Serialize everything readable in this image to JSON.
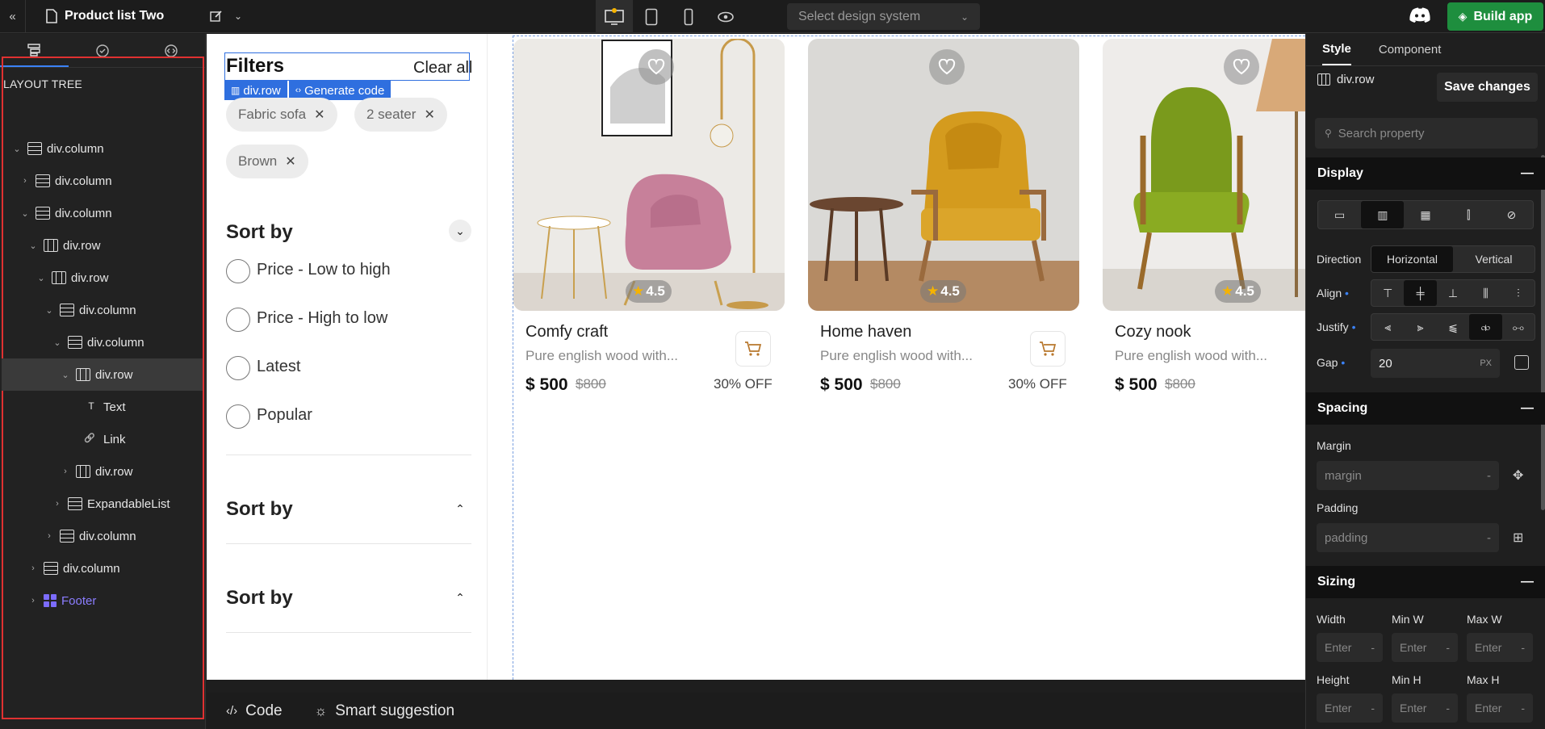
{
  "header": {
    "title": "Product list Two",
    "design_select_placeholder": "Select design system",
    "build_label": "Build app"
  },
  "left_panel": {
    "heading": "LAYOUT TREE",
    "tree": [
      {
        "label": "div.column",
        "icon": "column"
      },
      {
        "label": "div.column",
        "icon": "column"
      },
      {
        "label": "div.column",
        "icon": "column"
      },
      {
        "label": "div.row",
        "icon": "row"
      },
      {
        "label": "div.row",
        "icon": "row"
      },
      {
        "label": "div.column",
        "icon": "column"
      },
      {
        "label": "div.column",
        "icon": "column"
      },
      {
        "label": "div.row",
        "icon": "row"
      },
      {
        "label": "Text",
        "icon": "text"
      },
      {
        "label": "Link",
        "icon": "link"
      },
      {
        "label": "div.row",
        "icon": "row"
      },
      {
        "label": "ExpandableList",
        "icon": "list"
      },
      {
        "label": "div.column",
        "icon": "column"
      },
      {
        "label": "div.column",
        "icon": "column"
      },
      {
        "label": "Footer",
        "icon": "component"
      }
    ]
  },
  "canvas": {
    "filters": {
      "title": "Filters",
      "clear_all": "Clear all",
      "selection_tag": "div.row",
      "generate_code": "Generate code",
      "chips": [
        "Fabric sofa",
        "2 seater",
        "Brown"
      ],
      "sort_heading": "Sort by",
      "sort_options": [
        "Price - Low to high",
        "Price - High to low",
        "Latest",
        "Popular"
      ],
      "collapsed_sections": [
        "Sort by",
        "Sort by"
      ]
    },
    "products": [
      {
        "name": "Comfy craft",
        "desc": "Pure english wood with...",
        "price": "$ 500",
        "old_price": "$800",
        "discount": "30% OFF",
        "rating": "4.5"
      },
      {
        "name": "Home haven",
        "desc": "Pure english wood with...",
        "price": "$ 500",
        "old_price": "$800",
        "discount": "30% OFF",
        "rating": "4.5"
      },
      {
        "name": "Cozy nook",
        "desc": "Pure english wood with...",
        "price": "$ 500",
        "old_price": "$800",
        "discount": "",
        "rating": "4.5"
      }
    ]
  },
  "bottom_bar": {
    "code": "Code",
    "smart": "Smart suggestion"
  },
  "right_panel": {
    "tabs": [
      "Style",
      "Component"
    ],
    "selected": "div.row",
    "save_label": "Save changes",
    "search_placeholder": "Search property",
    "display": {
      "heading": "Display",
      "direction_label": "Direction",
      "direction_options": [
        "Horizontal",
        "Vertical"
      ],
      "align_label": "Align",
      "justify_label": "Justify",
      "gap_label": "Gap",
      "gap_value": "20",
      "gap_unit": "PX"
    },
    "spacing": {
      "heading": "Spacing",
      "margin_label": "Margin",
      "margin_placeholder": "margin",
      "padding_label": "Padding",
      "padding_placeholder": "padding"
    },
    "sizing": {
      "heading": "Sizing",
      "labels": [
        "Width",
        "Min W",
        "Max W",
        "Height",
        "Min H",
        "Max H"
      ],
      "placeholder": "Enter"
    }
  },
  "colors": {
    "accent": "#3b82f6",
    "build": "#1e8e3e",
    "selection": "#2f6fdf",
    "highlight_border": "#e03131"
  }
}
